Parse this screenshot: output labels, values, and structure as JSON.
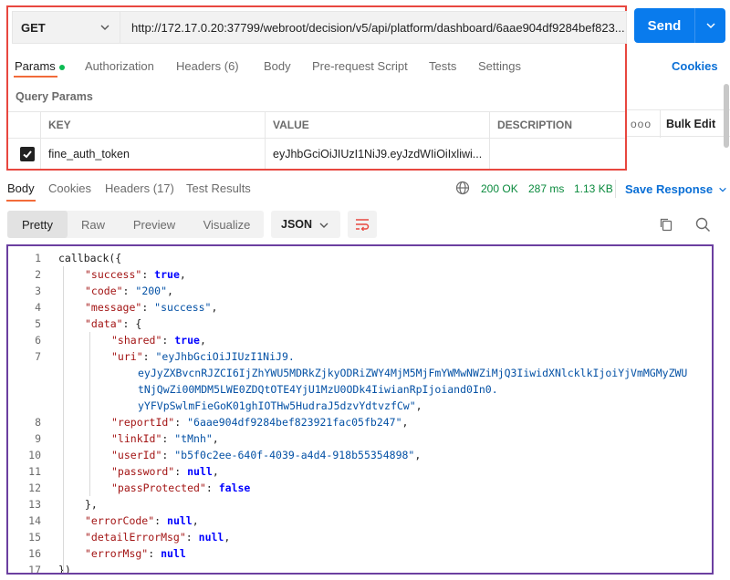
{
  "request": {
    "method": "GET",
    "url": "http://172.17.0.20:37799/webroot/decision/v5/api/platform/dashboard/6aae904df9284bef823...",
    "send_label": "Send",
    "tabs": [
      {
        "label": "Params",
        "active": true,
        "dot": true
      },
      {
        "label": "Authorization"
      },
      {
        "label": "Headers (6)"
      },
      {
        "label": "Body"
      },
      {
        "label": "Pre-request Script"
      },
      {
        "label": "Tests"
      },
      {
        "label": "Settings"
      }
    ],
    "cookies_label": "Cookies",
    "query_params_title": "Query Params",
    "columns": {
      "key": "KEY",
      "value": "VALUE",
      "description": "DESCRIPTION",
      "bulk_edit": "Bulk Edit",
      "more": "ooo"
    },
    "params": [
      {
        "checked": true,
        "key": "fine_auth_token",
        "value": "eyJhbGciOiJIUzI1NiJ9.eyJzdWIiOiIxliwi...",
        "description": ""
      }
    ]
  },
  "response": {
    "tabs": [
      {
        "label": "Body",
        "active": true
      },
      {
        "label": "Cookies"
      },
      {
        "label": "Headers (17)"
      },
      {
        "label": "Test Results"
      }
    ],
    "status": "200 OK",
    "time": "287 ms",
    "size": "1.13 KB",
    "save_label": "Save Response",
    "formats": [
      {
        "label": "Pretty",
        "active": true
      },
      {
        "label": "Raw"
      },
      {
        "label": "Preview"
      },
      {
        "label": "Visualize"
      }
    ],
    "language": "JSON",
    "colors": {
      "accent": "#097bed",
      "status_green": "#0a8a3d",
      "key": "#a31515",
      "string": "#0451a5",
      "literal": "#0000ff",
      "request_outline": "#e8473f",
      "body_outline": "#6b3fa0"
    },
    "code_lines": [
      {
        "n": "1",
        "indent": 0,
        "parts": [
          [
            "p",
            "callback({"
          ]
        ]
      },
      {
        "n": "2",
        "indent": 1,
        "parts": [
          [
            "k",
            "\"success\""
          ],
          [
            "p",
            ": "
          ],
          [
            "b",
            "true"
          ],
          [
            "p",
            ","
          ]
        ]
      },
      {
        "n": "3",
        "indent": 1,
        "parts": [
          [
            "k",
            "\"code\""
          ],
          [
            "p",
            ": "
          ],
          [
            "s",
            "\"200\""
          ],
          [
            "p",
            ","
          ]
        ]
      },
      {
        "n": "4",
        "indent": 1,
        "parts": [
          [
            "k",
            "\"message\""
          ],
          [
            "p",
            ": "
          ],
          [
            "s",
            "\"success\""
          ],
          [
            "p",
            ","
          ]
        ]
      },
      {
        "n": "5",
        "indent": 1,
        "parts": [
          [
            "k",
            "\"data\""
          ],
          [
            "p",
            ": {"
          ]
        ]
      },
      {
        "n": "6",
        "indent": 2,
        "parts": [
          [
            "k",
            "\"shared\""
          ],
          [
            "p",
            ": "
          ],
          [
            "b",
            "true"
          ],
          [
            "p",
            ","
          ]
        ]
      },
      {
        "n": "7",
        "indent": 2,
        "parts": [
          [
            "k",
            "\"uri\""
          ],
          [
            "p",
            ": "
          ],
          [
            "s",
            "\"eyJhbGciOiJIUzI1NiJ9."
          ]
        ]
      },
      {
        "n": "",
        "indent": 3,
        "parts": [
          [
            "s",
            "eyJyZXBvcnRJZCI6IjZhYWU5MDRkZjkyODRiZWY4MjM5MjFmYWMwNWZiMjQ3IiwidXNlcklkIjoiYjVmMGMyZWU"
          ]
        ]
      },
      {
        "n": "",
        "indent": 3,
        "parts": [
          [
            "s",
            "tNjQwZi00MDM5LWE0ZDQtOTE4YjU1MzU0ODk4IiwianRpIjoiand0In0."
          ]
        ]
      },
      {
        "n": "",
        "indent": 3,
        "parts": [
          [
            "s",
            "yYFVpSwlmFieGoK01ghIOTHw5HudraJ5dzvYdtvzfCw\""
          ],
          [
            "p",
            ","
          ]
        ]
      },
      {
        "n": "8",
        "indent": 2,
        "parts": [
          [
            "k",
            "\"reportId\""
          ],
          [
            "p",
            ": "
          ],
          [
            "s",
            "\"6aae904df9284bef823921fac05fb247\""
          ],
          [
            "p",
            ","
          ]
        ]
      },
      {
        "n": "9",
        "indent": 2,
        "parts": [
          [
            "k",
            "\"linkId\""
          ],
          [
            "p",
            ": "
          ],
          [
            "s",
            "\"tMnh\""
          ],
          [
            "p",
            ","
          ]
        ]
      },
      {
        "n": "10",
        "indent": 2,
        "parts": [
          [
            "k",
            "\"userId\""
          ],
          [
            "p",
            ": "
          ],
          [
            "s",
            "\"b5f0c2ee-640f-4039-a4d4-918b55354898\""
          ],
          [
            "p",
            ","
          ]
        ]
      },
      {
        "n": "11",
        "indent": 2,
        "parts": [
          [
            "k",
            "\"password\""
          ],
          [
            "p",
            ": "
          ],
          [
            "b",
            "null"
          ],
          [
            "p",
            ","
          ]
        ]
      },
      {
        "n": "12",
        "indent": 2,
        "parts": [
          [
            "k",
            "\"passProtected\""
          ],
          [
            "p",
            ": "
          ],
          [
            "b",
            "false"
          ]
        ]
      },
      {
        "n": "13",
        "indent": 1,
        "parts": [
          [
            "p",
            "},"
          ]
        ]
      },
      {
        "n": "14",
        "indent": 1,
        "parts": [
          [
            "k",
            "\"errorCode\""
          ],
          [
            "p",
            ": "
          ],
          [
            "b",
            "null"
          ],
          [
            "p",
            ","
          ]
        ]
      },
      {
        "n": "15",
        "indent": 1,
        "parts": [
          [
            "k",
            "\"detailErrorMsg\""
          ],
          [
            "p",
            ": "
          ],
          [
            "b",
            "null"
          ],
          [
            "p",
            ","
          ]
        ]
      },
      {
        "n": "16",
        "indent": 1,
        "parts": [
          [
            "k",
            "\"errorMsg\""
          ],
          [
            "p",
            ": "
          ],
          [
            "b",
            "null"
          ]
        ]
      },
      {
        "n": "17",
        "indent": 0,
        "parts": [
          [
            "p",
            "})"
          ]
        ]
      }
    ]
  }
}
